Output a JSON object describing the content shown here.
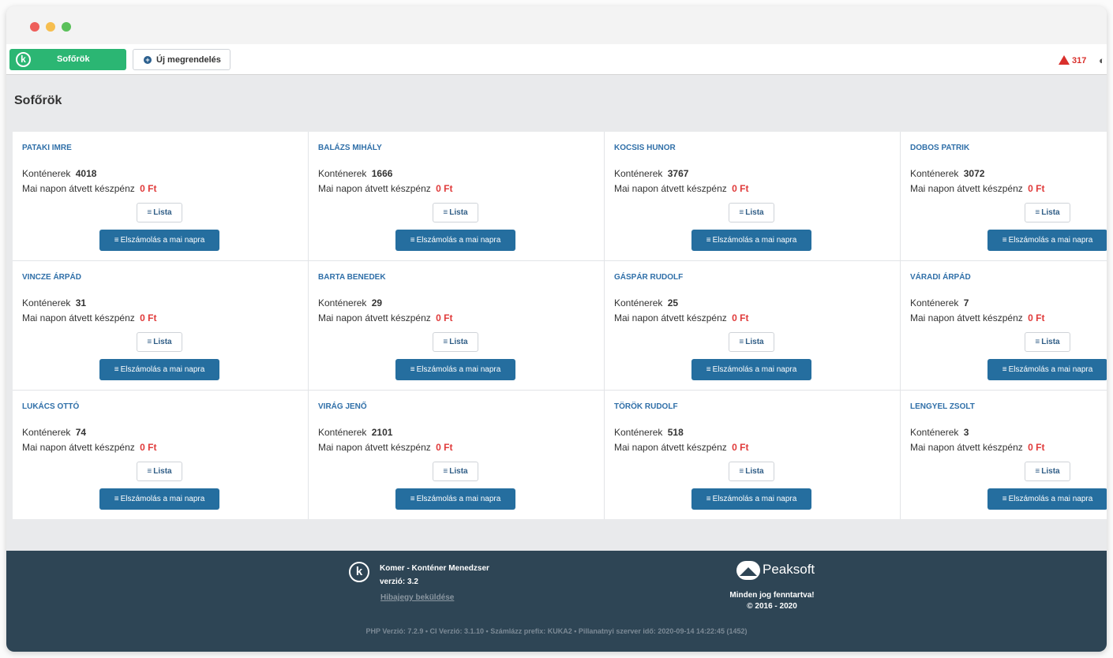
{
  "navbar": {
    "brand_logo": "k",
    "brand_label": "Sofőrök",
    "new_order_label": "Új megrendelés",
    "alert_count": "317"
  },
  "page": {
    "title": "Sofőrök"
  },
  "labels": {
    "containers": "Konténerek",
    "cash_today": "Mai napon átvett készpénz",
    "list_button": "Lista",
    "settle_button": "Elszámolás a mai napra",
    "menu_icon": "≡"
  },
  "drivers": [
    {
      "name": "PATAKI IMRE",
      "containers": "4018",
      "cash": "0 Ft"
    },
    {
      "name": "BALÁZS MIHÁLY",
      "containers": "1666",
      "cash": "0 Ft"
    },
    {
      "name": "KOCSIS HUNOR",
      "containers": "3767",
      "cash": "0 Ft"
    },
    {
      "name": "DOBOS PATRIK",
      "containers": "3072",
      "cash": "0 Ft"
    },
    {
      "name": "VINCZE ÁRPÁD",
      "containers": "31",
      "cash": "0 Ft"
    },
    {
      "name": "BARTA BENEDEK",
      "containers": "29",
      "cash": "0 Ft"
    },
    {
      "name": "GÁSPÁR RUDOLF",
      "containers": "25",
      "cash": "0 Ft"
    },
    {
      "name": "VÁRADI ÁRPÁD",
      "containers": "7",
      "cash": "0 Ft"
    },
    {
      "name": "LUKÁCS OTTÓ",
      "containers": "74",
      "cash": "0 Ft"
    },
    {
      "name": "VIRÁG JENŐ",
      "containers": "2101",
      "cash": "0 Ft"
    },
    {
      "name": "TÖRÖK RUDOLF",
      "containers": "518",
      "cash": "0 Ft"
    },
    {
      "name": "LENGYEL ZSOLT",
      "containers": "3",
      "cash": "0 Ft"
    }
  ],
  "footer": {
    "app_name": "Komer - Konténer Menedzser",
    "version": "verzió: 3.2",
    "bug_link": "Hibajegy beküldése",
    "company": "Peaksoft",
    "rights": "Minden jog fenntartva!",
    "years": "© 2016 - 2020",
    "meta": "PHP Verzió: 7.2.9 • CI Verzió: 3.1.10 • Számlázz prefix: KUKA2 • Pillanatnyi szerver idő: 2020-09-14 14:22:45 (1452)"
  },
  "colors": {
    "brand_green": "#2bb673",
    "link_blue": "#2f6fa8",
    "button_blue": "#256e9f",
    "cash_red": "#e03a3a",
    "footer_bg": "#2e4555"
  },
  "icons": {
    "alert": "warning-triangle-icon",
    "user": "user-circle-icon",
    "new_order": "plus-circle-icon",
    "list": "list-lines-icon"
  }
}
